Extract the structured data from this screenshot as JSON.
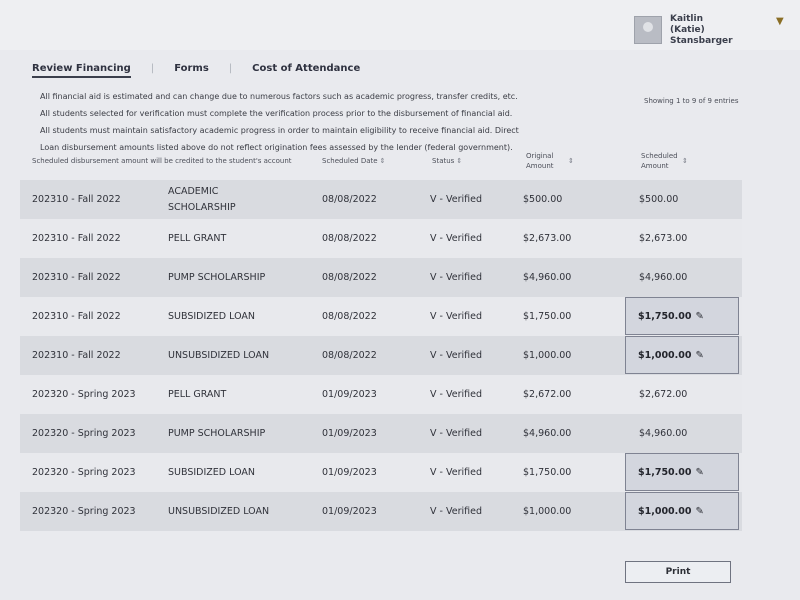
{
  "user": {
    "name_line1": "Kaitlin",
    "name_line2": "(Katie)",
    "name_line3": "Stansbarger"
  },
  "tabs": [
    "Review Financing",
    "Forms",
    "Cost of Attendance"
  ],
  "notice": [
    "All financial aid is estimated and can change due to numerous factors such as academic progress, transfer credits, etc.",
    "All students selected for verification must complete the verification process prior to the disbursement of financial aid.",
    "All students must maintain satisfactory academic progress in order to maintain eligibility to receive financial aid. Direct",
    "Loan disbursement amounts listed above do not reflect origination fees assessed by the lender (federal government)."
  ],
  "showing": "Showing 1 to 9 of 9 entries",
  "headers": {
    "term": "Scheduled disbursement amount will be credited to the student's account",
    "fund": "",
    "date": "Scheduled Date",
    "status": "Status",
    "original": "Original Amount",
    "scheduled": "Scheduled Amount"
  },
  "rows": [
    {
      "term": "202310 - Fall 2022",
      "fund": "ACADEMIC SCHOLARSHIP",
      "date": "08/08/2022",
      "status": "V - Verified",
      "original": "$500.00",
      "scheduled": "$500.00",
      "editable": false
    },
    {
      "term": "202310 - Fall 2022",
      "fund": "PELL GRANT",
      "date": "08/08/2022",
      "status": "V - Verified",
      "original": "$2,673.00",
      "scheduled": "$2,673.00",
      "editable": false
    },
    {
      "term": "202310 - Fall 2022",
      "fund": "PUMP SCHOLARSHIP",
      "date": "08/08/2022",
      "status": "V - Verified",
      "original": "$4,960.00",
      "scheduled": "$4,960.00",
      "editable": false
    },
    {
      "term": "202310 - Fall 2022",
      "fund": "SUBSIDIZED LOAN",
      "date": "08/08/2022",
      "status": "V - Verified",
      "original": "$1,750.00",
      "scheduled": "$1,750.00",
      "editable": true
    },
    {
      "term": "202310 - Fall 2022",
      "fund": "UNSUBSIDIZED LOAN",
      "date": "08/08/2022",
      "status": "V - Verified",
      "original": "$1,000.00",
      "scheduled": "$1,000.00",
      "editable": true
    },
    {
      "term": "202320 - Spring 2023",
      "fund": "PELL GRANT",
      "date": "01/09/2023",
      "status": "V - Verified",
      "original": "$2,672.00",
      "scheduled": "$2,672.00",
      "editable": false
    },
    {
      "term": "202320 - Spring 2023",
      "fund": "PUMP SCHOLARSHIP",
      "date": "01/09/2023",
      "status": "V - Verified",
      "original": "$4,960.00",
      "scheduled": "$4,960.00",
      "editable": false
    },
    {
      "term": "202320 - Spring 2023",
      "fund": "SUBSIDIZED LOAN",
      "date": "01/09/2023",
      "status": "V - Verified",
      "original": "$1,750.00",
      "scheduled": "$1,750.00",
      "editable": true
    },
    {
      "term": "202320 - Spring 2023",
      "fund": "UNSUBSIDIZED LOAN",
      "date": "01/09/2023",
      "status": "V - Verified",
      "original": "$1,000.00",
      "scheduled": "$1,000.00",
      "editable": true
    }
  ],
  "print_label": "Print"
}
